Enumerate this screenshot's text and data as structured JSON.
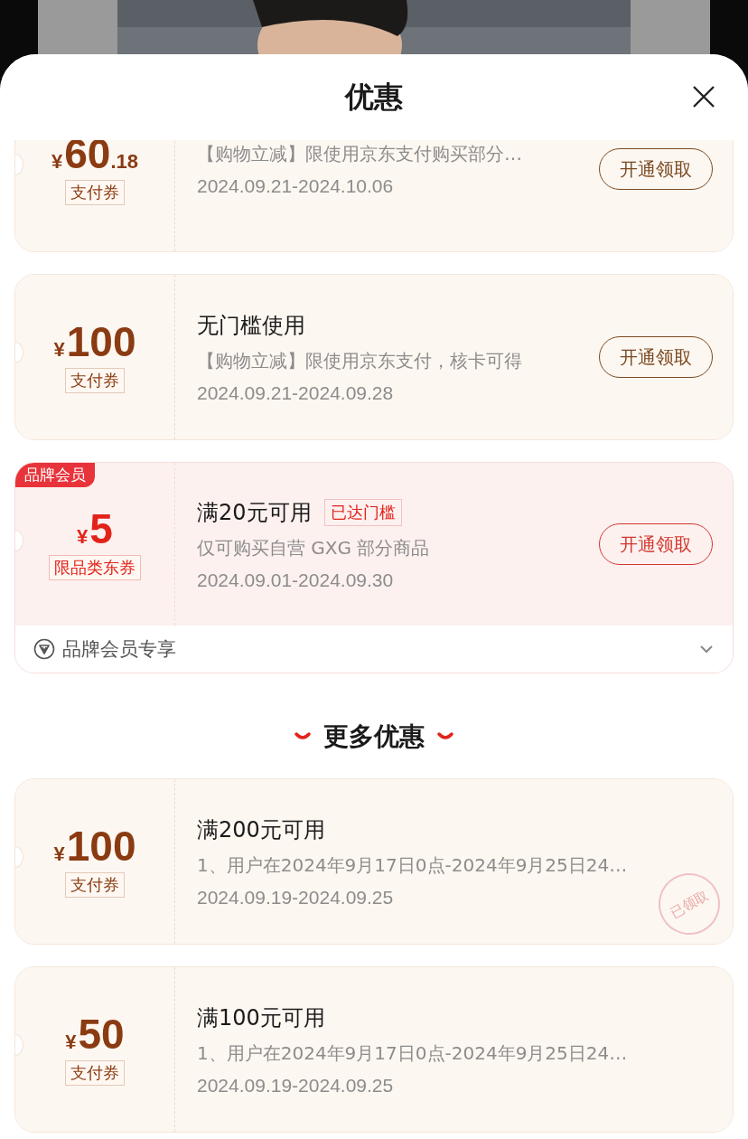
{
  "sheet": {
    "title": "优惠"
  },
  "coupons": [
    {
      "kind": "pay",
      "currency": "¥",
      "amount": "60",
      "decimal": ".18",
      "tag": "支付券",
      "description": "【购物立减】限使用京东支付购买部分…",
      "validity": "2024.09.21-2024.10.06",
      "button": "开通领取"
    },
    {
      "kind": "pay",
      "currency": "¥",
      "amount": "100",
      "tag": "支付券",
      "title": "无门槛使用",
      "description": "【购物立减】限使用京东支付，核卡可得",
      "validity": "2024.09.21-2024.09.28",
      "button": "开通领取"
    },
    {
      "kind": "member",
      "badge": "品牌会员",
      "currency": "¥",
      "amount": "5",
      "tag": "限品类东券",
      "title": "满20元可用",
      "threshold_tag": "已达门槛",
      "description": "仅可购买自营 GXG 部分商品",
      "validity": "2024.09.01-2024.09.30",
      "button": "开通领取",
      "footer": "品牌会员专享"
    }
  ],
  "more_section": {
    "heading": "更多优惠",
    "coupons": [
      {
        "kind": "pay",
        "currency": "¥",
        "amount": "100",
        "tag": "支付券",
        "title": "满200元可用",
        "description": "1、用户在2024年9月17日0点-2024年9月25日24…",
        "validity": "2024.09.19-2024.09.25",
        "stamp": "已领取"
      },
      {
        "kind": "pay",
        "currency": "¥",
        "amount": "50",
        "tag": "支付券",
        "title": "满100元可用",
        "description": "1、用户在2024年9月17日0点-2024年9月25日24…",
        "validity": "2024.09.19-2024.09.25"
      }
    ]
  }
}
